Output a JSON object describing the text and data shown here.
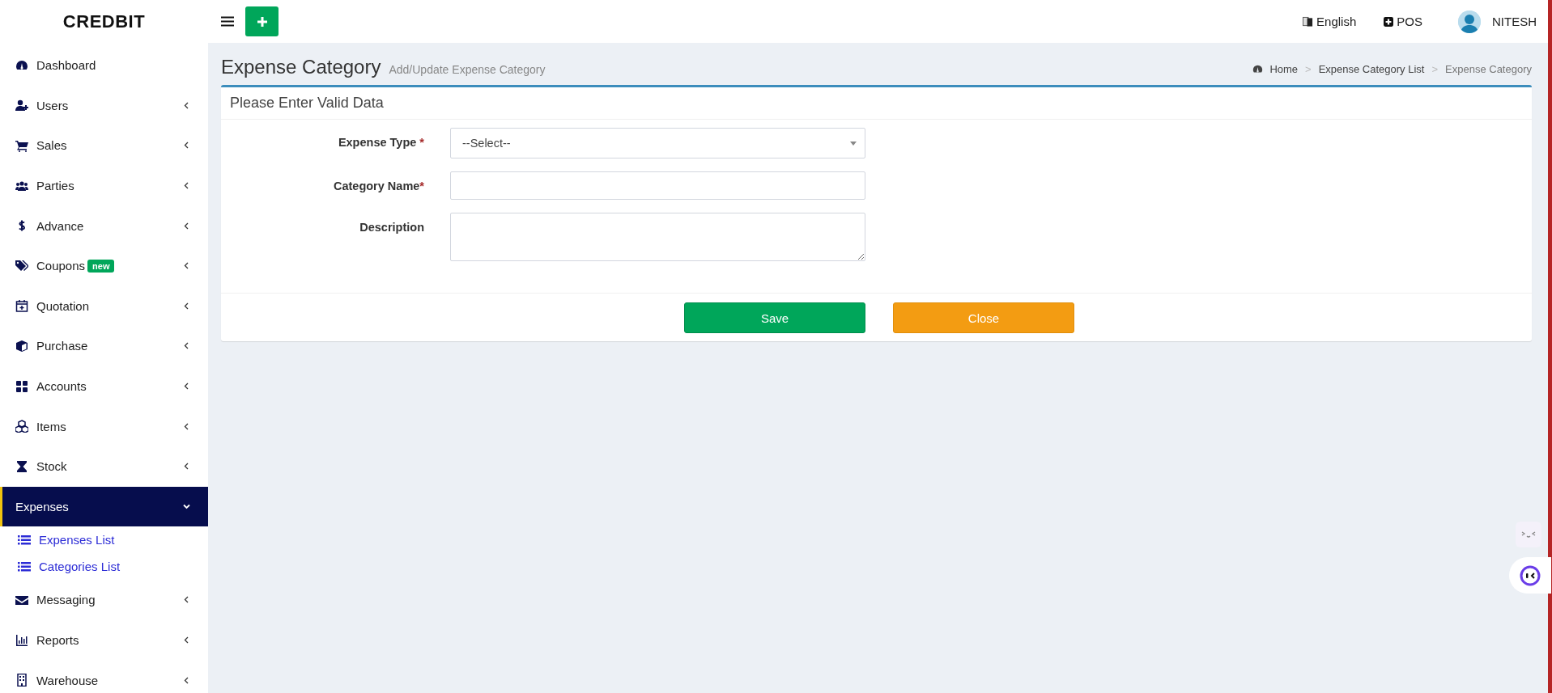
{
  "brand": "CREDBIT",
  "header": {
    "language": "English",
    "pos": "POS",
    "user": "NITESH"
  },
  "sidebar": {
    "items": [
      {
        "label": "Dashboard",
        "kind": "link",
        "selected": false
      },
      {
        "label": "Users",
        "kind": "menu",
        "expanded": false,
        "selected": false
      },
      {
        "label": "Sales",
        "kind": "menu",
        "expanded": false,
        "selected": false
      },
      {
        "label": "Parties",
        "kind": "menu",
        "expanded": false,
        "selected": false
      },
      {
        "label": "Advance",
        "kind": "menu",
        "expanded": false,
        "selected": false
      },
      {
        "label": "Coupons",
        "kind": "menu",
        "expanded": false,
        "selected": false,
        "badge": "new"
      },
      {
        "label": "Quotation",
        "kind": "menu",
        "expanded": false,
        "selected": false
      },
      {
        "label": "Purchase",
        "kind": "menu",
        "expanded": false,
        "selected": false
      },
      {
        "label": "Accounts",
        "kind": "menu",
        "expanded": false,
        "selected": false
      },
      {
        "label": "Items",
        "kind": "menu",
        "expanded": false,
        "selected": false
      },
      {
        "label": "Stock",
        "kind": "menu",
        "expanded": false,
        "selected": false
      },
      {
        "label": "Expenses",
        "kind": "menu",
        "expanded": true,
        "selected": true,
        "children": [
          {
            "label": "Expenses List",
            "selected": false
          },
          {
            "label": "Categories List",
            "selected": false
          }
        ]
      },
      {
        "label": "Messaging",
        "kind": "menu",
        "expanded": false,
        "selected": false
      },
      {
        "label": "Reports",
        "kind": "menu",
        "expanded": false,
        "selected": false
      },
      {
        "label": "Warehouse",
        "kind": "menu",
        "expanded": false,
        "selected": false
      }
    ]
  },
  "page": {
    "title": "Expense Category",
    "subtitle": "Add/Update Expense Category"
  },
  "breadcrumb": [
    {
      "kind": "link",
      "label": "Home"
    },
    {
      "kind": "separator",
      "label": ">"
    },
    {
      "kind": "link",
      "label": "Expense Category List"
    },
    {
      "kind": "separator",
      "label": ">"
    },
    {
      "kind": "current",
      "label": "Expense Category"
    }
  ],
  "form": {
    "heading": "Please Enter Valid Data",
    "fields": [
      {
        "kind": "select",
        "label": "Expense Type",
        "required": "*",
        "value": "--Select--"
      },
      {
        "kind": "text",
        "label": "Category Name",
        "required": "*"
      },
      {
        "kind": "textarea",
        "label": "Description"
      }
    ],
    "buttons": [
      {
        "kind": "primary",
        "label": "Save"
      },
      {
        "kind": "warning",
        "label": "Close"
      }
    ]
  }
}
